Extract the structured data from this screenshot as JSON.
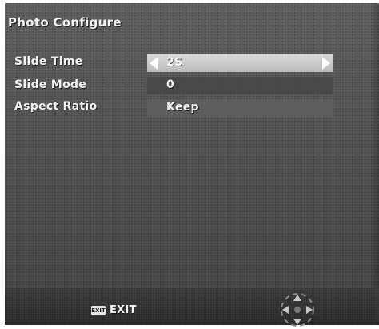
{
  "menu": {
    "title": "Photo Configure",
    "items": [
      {
        "label": "Slide Time",
        "value": "2S",
        "selected": true
      },
      {
        "label": "Slide Mode",
        "value": "0",
        "selected": false
      },
      {
        "label": "Aspect Ratio",
        "value": "Keep",
        "selected": false
      }
    ]
  },
  "footer": {
    "exit_key": "EXIT",
    "exit_label": "EXIT"
  },
  "icons": {
    "left_arrow": "left-arrow-icon",
    "right_arrow": "right-arrow-icon",
    "exit_key": "exit-key-icon",
    "dpad": "dpad-icon"
  }
}
